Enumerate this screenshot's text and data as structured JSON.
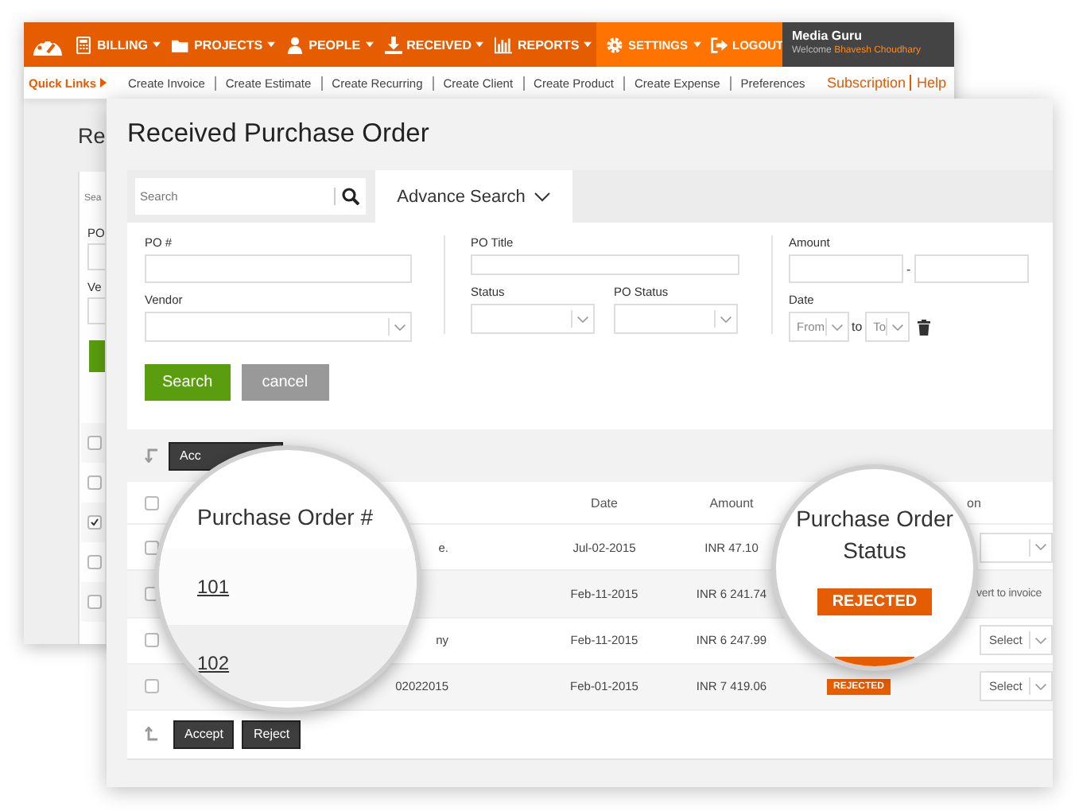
{
  "nav": {
    "items": [
      {
        "label": "BILLING",
        "dropdown": true
      },
      {
        "label": "PROJECTS",
        "dropdown": true
      },
      {
        "label": "PEOPLE",
        "dropdown": true
      },
      {
        "label": "RECEIVED",
        "dropdown": true
      },
      {
        "label": "REPORTS",
        "dropdown": true
      }
    ],
    "settings": [
      {
        "label": "SETTINGS",
        "dropdown": true
      },
      {
        "label": "LOGOUT",
        "dropdown": false
      }
    ],
    "user": {
      "company": "Media Guru",
      "welcome": "Welcome",
      "name": "Bhavesh Choudhary"
    }
  },
  "quick_links": {
    "title": "Quick Links",
    "links": [
      "Create Invoice",
      "Create Estimate",
      "Create Recurring",
      "Create Client",
      "Create Product",
      "Create Expense",
      "Preferences"
    ],
    "right_links": [
      "Subscription",
      "Help"
    ]
  },
  "back_panel": {
    "title": "Re",
    "search_placeholder": "Sea",
    "labels": [
      "PO",
      "Ve"
    ],
    "rows": [
      {
        "checked": false
      },
      {
        "checked": false
      },
      {
        "checked": true
      },
      {
        "checked": false
      },
      {
        "checked": false
      }
    ]
  },
  "panel": {
    "title": "Received Purchase Order",
    "search": {
      "placeholder": "Search"
    },
    "advance_tab": "Advance Search",
    "form": {
      "po_number": "PO #",
      "vendor": "Vendor",
      "po_title": "PO Title",
      "status": "Status",
      "po_status": "PO Status",
      "amount": "Amount",
      "amount_separator": "-",
      "date": "Date",
      "date_from": "From",
      "date_joiner": "to",
      "date_to": "To"
    },
    "form_buttons": [
      {
        "label": "Search",
        "kind": "primary"
      },
      {
        "label": "cancel",
        "kind": "secondary"
      }
    ],
    "top_actions": [
      "Acc"
    ],
    "table": {
      "select_all_checked": false,
      "columns": {
        "date": "Date",
        "amount": "Amount",
        "column_7": "on"
      },
      "rows": [
        {
          "checked": false,
          "title": "e.",
          "date": "Jul-02-2015",
          "amount": "INR 47.10",
          "action": {
            "kind": "select"
          }
        },
        {
          "checked": false,
          "date": "Feb-11-2015",
          "amount": "INR 6 241.74",
          "action": {
            "kind": "text",
            "value": "vert to invoice"
          }
        },
        {
          "checked": false,
          "title": "ny",
          "date": "Feb-11-2015",
          "amount": "INR 6 247.99",
          "action": {
            "kind": "select",
            "value": "Select"
          }
        },
        {
          "checked": false,
          "title": "02022015",
          "date": "Feb-01-2015",
          "amount": "INR 7 419.06",
          "status": "REJECTED",
          "action": {
            "kind": "select",
            "value": "Select"
          }
        }
      ]
    },
    "bottom_actions": [
      "Accept",
      "Reject"
    ]
  },
  "magnifiers": [
    {
      "kind": "links",
      "heading": "Purchase Order #",
      "items": [
        "101",
        "102"
      ]
    },
    {
      "kind": "badges",
      "heading": "Purchase Order Status",
      "items": [
        "REJECTED"
      ]
    }
  ]
}
